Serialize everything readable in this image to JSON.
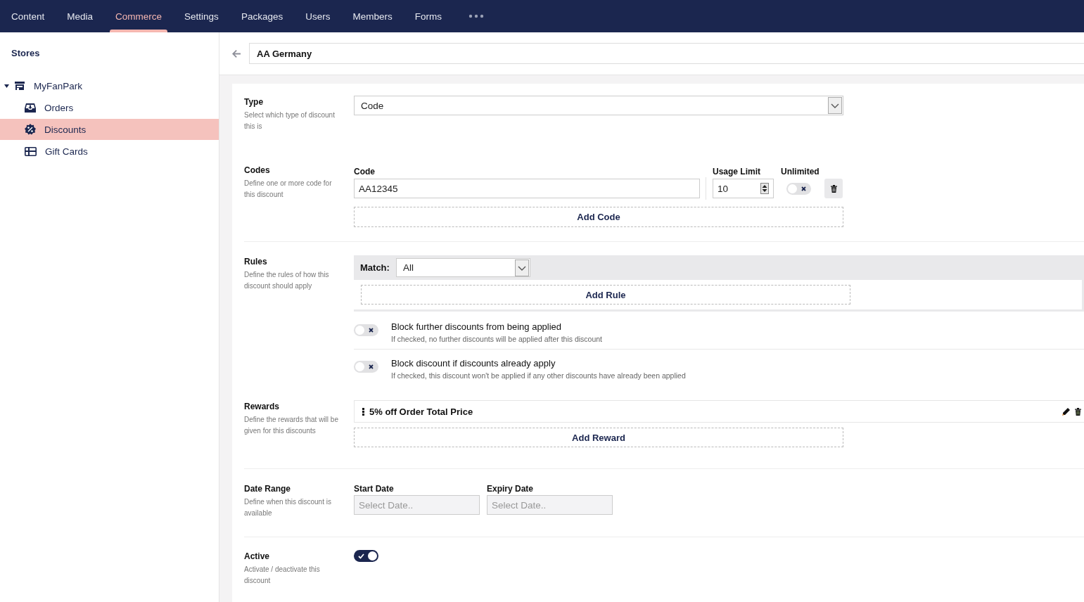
{
  "nav": [
    {
      "label": "Content",
      "selected": false
    },
    {
      "label": "Media",
      "selected": false
    },
    {
      "label": "Commerce",
      "selected": true
    },
    {
      "label": "Settings",
      "selected": false
    },
    {
      "label": "Packages",
      "selected": false
    },
    {
      "label": "Users",
      "selected": false
    },
    {
      "label": "Members",
      "selected": false
    },
    {
      "label": "Forms",
      "selected": false
    }
  ],
  "sidebar": {
    "title": "Stores",
    "tree": [
      {
        "label": "MyFanPark",
        "kind": "store",
        "expanded": true,
        "selected": false,
        "children": [
          {
            "label": "Orders",
            "kind": "tray",
            "selected": false
          },
          {
            "label": "Discounts",
            "kind": "percent",
            "selected": true
          },
          {
            "label": "Gift Cards",
            "kind": "card",
            "selected": false
          }
        ]
      }
    ]
  },
  "header": {
    "name": "AA Germany"
  },
  "form": {
    "type": {
      "label": "Type",
      "description": "Select which type of discount this is",
      "value": "Code"
    },
    "codes": {
      "label": "Codes",
      "description": "Define one or more code for this discount",
      "columns": [
        "Code",
        "Usage Limit",
        "Unlimited"
      ],
      "rows": [
        {
          "code": "AA12345",
          "usage_limit": "10",
          "unlimited": false
        }
      ],
      "add_button": "Add Code"
    },
    "rules": {
      "label": "Rules",
      "description": "Define the rules of how this discount should apply",
      "match_label": "Match:",
      "match_value": "All",
      "add_button": "Add Rule",
      "options": [
        {
          "title": "Block further discounts from being applied",
          "hint": "If checked, no further discounts will be applied after this discount",
          "on": false
        },
        {
          "title": "Block discount if discounts already apply",
          "hint": "If checked, this discount won't be applied if any other discounts have already been applied",
          "on": false
        }
      ]
    },
    "rewards": {
      "label": "Rewards",
      "description": "Define the rewards that will be given for this discounts",
      "items": [
        {
          "label": "5% off Order Total Price"
        }
      ],
      "add_button": "Add Reward"
    },
    "date_range": {
      "label": "Date Range",
      "description": "Define when this discount is available",
      "fields": [
        {
          "label": "Start Date",
          "placeholder": "Select Date.."
        },
        {
          "label": "Expiry Date",
          "placeholder": "Select Date.."
        }
      ]
    },
    "active": {
      "label": "Active",
      "description": "Activate / deactivate this discount",
      "on": true
    }
  }
}
